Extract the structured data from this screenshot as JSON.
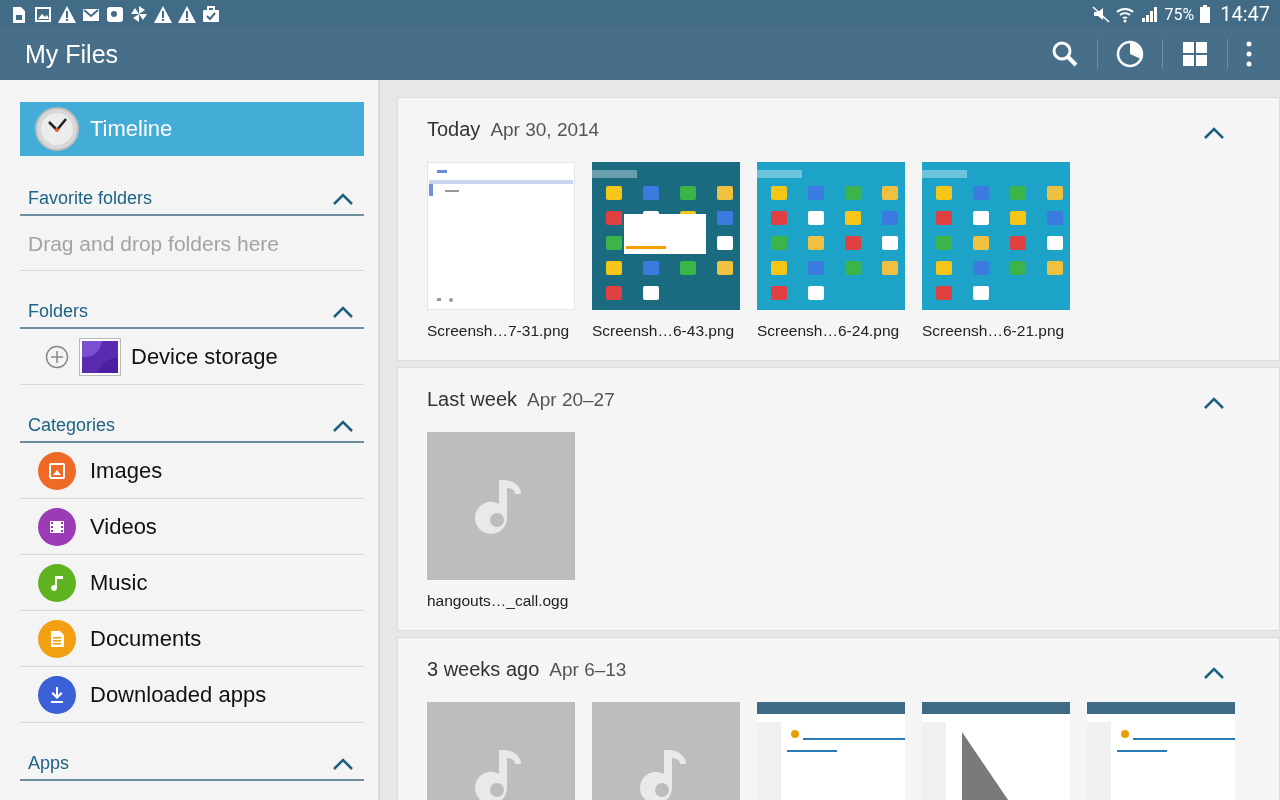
{
  "status_bar": {
    "left_icons": [
      {
        "kind": "sim"
      },
      {
        "kind": "image"
      },
      {
        "kind": "warning"
      },
      {
        "kind": "mail"
      },
      {
        "kind": "square"
      },
      {
        "kind": "pinwheel"
      },
      {
        "kind": "warning"
      },
      {
        "kind": "warning"
      },
      {
        "kind": "briefcase"
      }
    ],
    "battery_percent": "75%",
    "time": "14:47"
  },
  "app_bar": {
    "title": "My Files",
    "actions": [
      {
        "kind": "search"
      },
      {
        "kind": "storage"
      },
      {
        "kind": "grid"
      },
      {
        "kind": "more"
      }
    ]
  },
  "sidebar": {
    "timeline": {
      "label": "Timeline",
      "selected": true
    },
    "sections": [
      {
        "kind": "favorites",
        "title": "Favorite folders",
        "expanded": true,
        "placeholder": "Drag and drop folders here"
      },
      {
        "kind": "folders",
        "title": "Folders",
        "expanded": true,
        "items": [
          {
            "label": "Device storage",
            "expanded": false
          }
        ]
      },
      {
        "kind": "categories",
        "title": "Categories",
        "expanded": true,
        "items": [
          {
            "label": "Images",
            "kind": "images",
            "color": "#f06a27"
          },
          {
            "label": "Videos",
            "kind": "videos",
            "color": "#9b3bb5"
          },
          {
            "label": "Music",
            "kind": "music",
            "color": "#5fb320"
          },
          {
            "label": "Documents",
            "kind": "documents",
            "color": "#f2a012"
          },
          {
            "label": "Downloaded apps",
            "kind": "downloads",
            "color": "#3a5fd6"
          }
        ]
      },
      {
        "kind": "apps",
        "title": "Apps",
        "expanded": true
      }
    ]
  },
  "timeline": [
    {
      "title": "Today",
      "date": "Apr 30, 2014",
      "expanded": true,
      "files": [
        {
          "name": "Screensh…7-31.png",
          "kind": "document"
        },
        {
          "name": "Screensh…6-43.png",
          "kind": "home",
          "color": "#1a6a80"
        },
        {
          "name": "Screensh…6-24.png",
          "kind": "home",
          "color": "#1ea3c8"
        },
        {
          "name": "Screensh…6-21.png",
          "kind": "home",
          "color": "#1ea3c8"
        }
      ]
    },
    {
      "title": "Last week",
      "date": "Apr 20–27",
      "expanded": true,
      "files": [
        {
          "name": "hangouts…_call.ogg",
          "kind": "audio"
        }
      ]
    },
    {
      "title": "3 weeks ago",
      "date": "Apr 6–13",
      "expanded": true,
      "files": [
        {
          "kind": "audio"
        },
        {
          "kind": "audio"
        },
        {
          "kind": "web"
        },
        {
          "kind": "chart"
        },
        {
          "kind": "web"
        }
      ]
    }
  ]
}
